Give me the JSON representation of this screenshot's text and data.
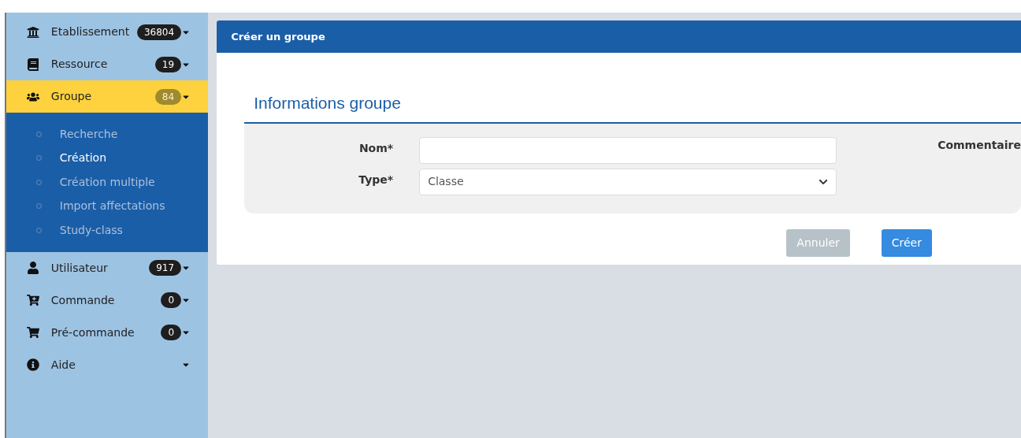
{
  "sidebar": {
    "items": [
      {
        "label": "Etablissement",
        "badge": "36804",
        "selected": false
      },
      {
        "label": "Ressource",
        "badge": "19",
        "selected": false
      },
      {
        "label": "Groupe",
        "badge": "84",
        "selected": true,
        "expanded": true,
        "children": [
          {
            "label": "Recherche",
            "selected": false
          },
          {
            "label": "Création",
            "selected": true
          },
          {
            "label": "Création multiple",
            "selected": false
          },
          {
            "label": "Import affectations",
            "selected": false
          },
          {
            "label": "Study-class",
            "selected": false
          }
        ]
      },
      {
        "label": "Utilisateur",
        "badge": "917",
        "selected": false
      },
      {
        "label": "Commande",
        "badge": "0",
        "selected": false
      },
      {
        "label": "Pré-commande",
        "badge": "0",
        "selected": false
      },
      {
        "label": "Aide",
        "selected": false
      }
    ]
  },
  "card": {
    "title": "Créer un groupe",
    "section_title": "Informations groupe",
    "fields": [
      {
        "kind": "text",
        "label": "Nom*"
      },
      {
        "kind": "select",
        "label": "Type*",
        "value": "Classe"
      }
    ],
    "comment_label": "Commentaire",
    "buttons": [
      {
        "kind": "secondary",
        "label": "Annuler"
      },
      {
        "kind": "primary",
        "label": "Créer"
      }
    ]
  }
}
